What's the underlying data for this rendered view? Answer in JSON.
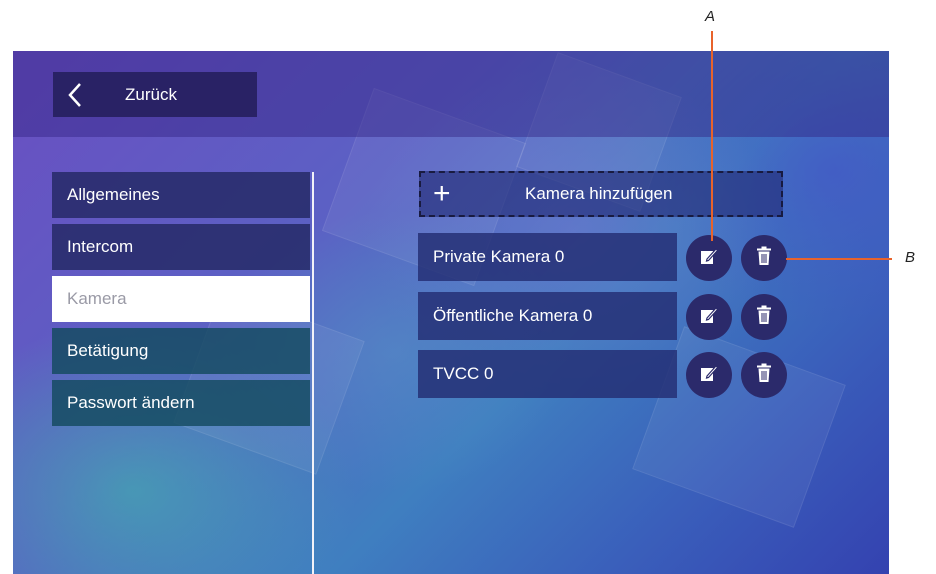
{
  "header": {
    "back_label": "Zurück"
  },
  "menu": {
    "items": [
      {
        "label": "Allgemeines"
      },
      {
        "label": "Intercom"
      },
      {
        "label": "Kamera"
      },
      {
        "label": "Betätigung"
      },
      {
        "label": "Passwort ändern"
      }
    ],
    "active": "Kamera"
  },
  "cameras": {
    "add_label": "Kamera hinzufügen",
    "items": [
      {
        "name": "Private Kamera 0"
      },
      {
        "name": "Öffentliche Kamera 0"
      },
      {
        "name": "TVCC 0"
      }
    ]
  },
  "callouts": {
    "a": "A",
    "b": "B"
  },
  "colors": {
    "callout_line": "#e8632b",
    "active_item_bg": "#ffffff",
    "button_circle": "#2b2a6b"
  }
}
